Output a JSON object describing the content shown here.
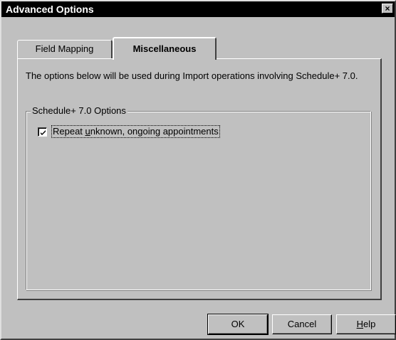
{
  "window": {
    "title": "Advanced Options",
    "close_glyph": "×"
  },
  "tabs": [
    {
      "label": "Field Mapping",
      "active": false
    },
    {
      "label": "Miscellaneous",
      "active": true
    }
  ],
  "misc": {
    "description": "The options below will be used during Import operations involving Schedule+ 7.0.",
    "group_label": "Schedule+ 7.0 Options",
    "option": {
      "label_before": "Repeat ",
      "label_accel": "u",
      "label_after": "nknown, ongoing appointments",
      "checked": true
    }
  },
  "buttons": {
    "ok": "OK",
    "cancel": "Cancel",
    "help_accel": "H",
    "help_rest": "elp"
  }
}
